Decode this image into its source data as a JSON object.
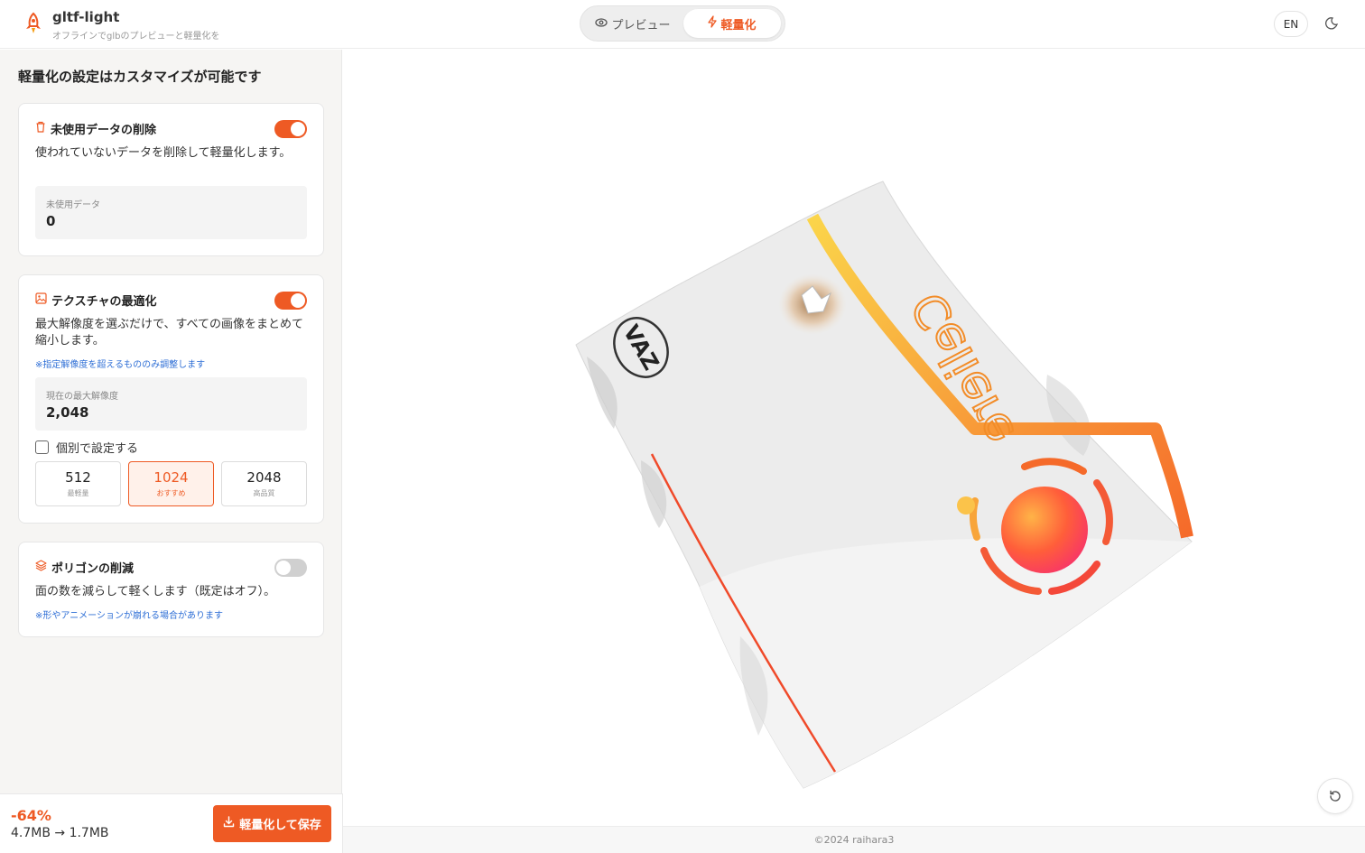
{
  "header": {
    "app_title": "gltf-light",
    "app_subtitle": "オフラインでglbのプレビューと軽量化を",
    "logo_icon": "rocket-icon",
    "tabs": [
      {
        "label": "プレビュー",
        "icon": "eye-icon",
        "active": false
      },
      {
        "label": "軽量化",
        "icon": "lightning-icon",
        "active": true
      }
    ],
    "lang_label": "EN",
    "theme_icon": "moon-icon"
  },
  "sidebar": {
    "title": "軽量化の設定はカスタマイズが可能です",
    "cards": [
      {
        "title": "未使用データの削除",
        "icon": "trash-icon",
        "enabled": true,
        "description": "使われていないデータを削除して軽量化します。",
        "stat_label": "未使用データ",
        "stat_value": "0"
      },
      {
        "title": "テクスチャの最適化",
        "icon": "image-icon",
        "enabled": true,
        "description": "最大解像度を選ぶだけで、すべての画像をまとめて縮小します。",
        "note": "※指定解像度を超えるもののみ調整します",
        "stat_label": "現在の最大解像度",
        "stat_value": "2,048",
        "checkbox_label": "個別で設定する",
        "checkbox_checked": false,
        "resolutions": [
          {
            "value": "512",
            "sub": "最軽量",
            "selected": false
          },
          {
            "value": "1024",
            "sub": "おすすめ",
            "selected": true
          },
          {
            "value": "2048",
            "sub": "高品質",
            "selected": false
          }
        ]
      },
      {
        "title": "ポリゴンの削減",
        "icon": "layers-icon",
        "enabled": false,
        "description": "面の数を減らして軽くします（既定はオフ）。",
        "note": "※形やアニメーションが崩れる場合があります"
      }
    ]
  },
  "bottom": {
    "reduction": "-64%",
    "sizes": "4.7MB → 1.7MB",
    "save_label": "軽量化して保存",
    "save_icon": "download-icon"
  },
  "viewer": {
    "model_logo_text": "VAZ",
    "model_text": "Celiere",
    "reset_icon": "reset-view-icon"
  },
  "footer": {
    "copyright": "©2024 raihara3"
  },
  "colors": {
    "accent": "#ee5a24",
    "note_blue": "#2f6fd6"
  }
}
